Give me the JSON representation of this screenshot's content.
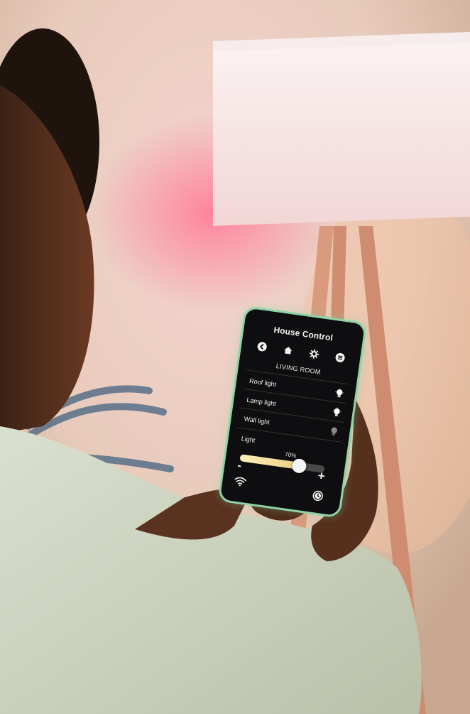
{
  "app": {
    "title": "House Control",
    "room": "LIVING ROOM",
    "toolbar": [
      {
        "icon": "back-arrow-icon"
      },
      {
        "icon": "home-icon"
      },
      {
        "icon": "settings-gear-icon"
      },
      {
        "icon": "menu-icon"
      }
    ],
    "lights": [
      {
        "label": "Roof light",
        "icon": "lightbulb-on-icon",
        "on": true
      },
      {
        "label": "Lamp light",
        "icon": "lightbulb-on-icon",
        "on": true
      },
      {
        "label": "Wall light",
        "icon": "lightbulb-off-icon",
        "on": false
      }
    ],
    "brightness": {
      "label": "Light",
      "value_text": "70%",
      "value": 0.7,
      "minus_label": "-",
      "plus_label": "+"
    },
    "footer": {
      "left_icon": "wifi-icon",
      "right_icon": "clock-icon"
    },
    "colors": {
      "phone_frame": "#8fd3a8",
      "screen_bg": "#0e0e10",
      "slider_fill": "#e9cf82",
      "lamp_glow": "#ff6f8e"
    }
  }
}
